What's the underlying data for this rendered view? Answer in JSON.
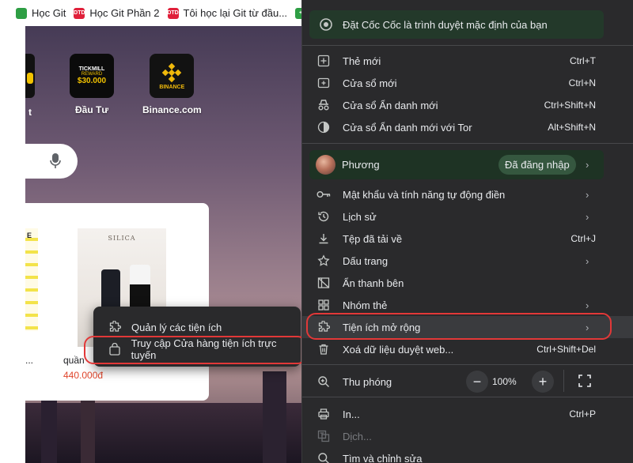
{
  "bookmarks": [
    {
      "label": "Học Git",
      "badge": "",
      "color": "#2e9e44"
    },
    {
      "label": "Học Git Phần 2",
      "badge": "DTD",
      "color": "#e0203a"
    },
    {
      "label": "Tôi học lại Git từ đầu...",
      "badge": "DTD",
      "color": "#e0203a"
    },
    {
      "label": "",
      "badge": "+",
      "color": "#2e9e44"
    }
  ],
  "tiles": [
    {
      "label": "Đầu Tư",
      "icon_text_1": "TICKMILL",
      "icon_text_2": "REWARD",
      "icon_text_3": "$30.000"
    },
    {
      "label": "Binance.com",
      "icon_text": "BINANCE"
    }
  ],
  "partial_tile_label": "t",
  "product": {
    "brand_text": "SILICA",
    "name": "quần",
    "price": "440.000đ",
    "left_ellipsis": "...",
    "left_tag": "E"
  },
  "submenu": {
    "items": [
      {
        "label": "Quản lý các tiện ích",
        "icon": "puzzle-icon"
      },
      {
        "label": "Truy cập Cửa hàng tiện ích trực tuyến",
        "icon": "store-bag-icon"
      }
    ]
  },
  "menu": {
    "promo": "Đặt Cốc Cốc là trình duyệt mặc định của bạn",
    "group1": [
      {
        "label": "Thẻ mới",
        "shortcut": "Ctrl+T",
        "icon": "new-tab-icon"
      },
      {
        "label": "Cửa sổ mới",
        "shortcut": "Ctrl+N",
        "icon": "new-window-icon"
      },
      {
        "label": "Cửa sổ Ẩn danh mới",
        "shortcut": "Ctrl+Shift+N",
        "icon": "incognito-icon"
      },
      {
        "label": "Cửa sổ Ẩn danh mới với Tor",
        "shortcut": "Alt+Shift+N",
        "icon": "tor-icon"
      }
    ],
    "profile": {
      "name": "Phương",
      "status": "Đã đăng nhập"
    },
    "group2": [
      {
        "label": "Mật khẩu và tính năng tự động điền",
        "shortcut": "",
        "arrow": true,
        "icon": "key-icon"
      },
      {
        "label": "Lịch sử",
        "shortcut": "",
        "arrow": true,
        "icon": "history-icon"
      },
      {
        "label": "Tệp đã tải về",
        "shortcut": "Ctrl+J",
        "arrow": false,
        "icon": "download-icon"
      },
      {
        "label": "Dấu trang",
        "shortcut": "",
        "arrow": true,
        "icon": "star-icon"
      },
      {
        "label": "Ẩn thanh bên",
        "shortcut": "",
        "arrow": false,
        "icon": "sidebar-hide-icon"
      },
      {
        "label": "Nhóm thẻ",
        "shortcut": "",
        "arrow": true,
        "icon": "grid-icon"
      },
      {
        "label": "Tiện ích mở rộng",
        "shortcut": "",
        "arrow": true,
        "icon": "puzzle-icon"
      },
      {
        "label": "Xoá dữ liệu duyệt web...",
        "shortcut": "Ctrl+Shift+Del",
        "arrow": false,
        "icon": "trash-icon"
      }
    ],
    "zoom": {
      "label": "Thu phóng",
      "value": "100%",
      "minus": "−",
      "plus": "+"
    },
    "group3": [
      {
        "label": "In...",
        "shortcut": "Ctrl+P",
        "icon": "print-icon",
        "disabled": false
      },
      {
        "label": "Dịch...",
        "shortcut": "",
        "icon": "translate-icon",
        "disabled": true
      },
      {
        "label": "Tìm và chỉnh sửa",
        "shortcut": "",
        "icon": "search-icon",
        "disabled": false
      }
    ],
    "arrow_glyph": "›"
  },
  "colors": {
    "highlight": "#e23838",
    "menu_bg": "#2a2a2c",
    "profile_bg": "#1e3324",
    "promo_bg": "#23392a",
    "price": "#e0452b"
  }
}
